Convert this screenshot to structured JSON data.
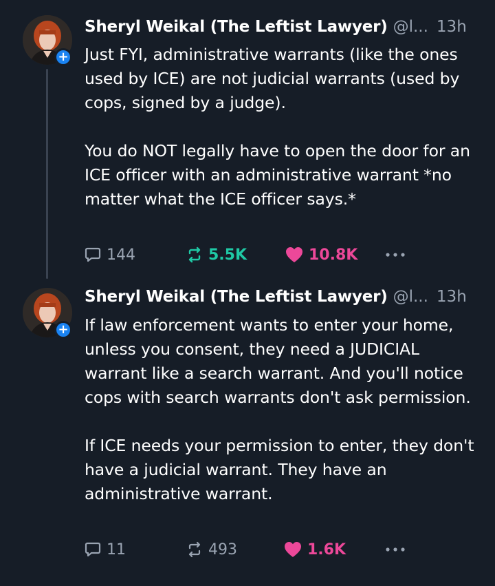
{
  "colors": {
    "background": "#161d27",
    "text": "#ffffff",
    "muted": "#9aa4b2",
    "repost_active": "#1fc9a5",
    "like_active": "#ec4899",
    "follow_badge": "#1a83f2",
    "thread_line": "#3a4351"
  },
  "posts": [
    {
      "author": {
        "display_name": "Sheryl Weikal (The Leftist Lawyer)",
        "handle": "@l...",
        "avatar_icon": "user-avatar"
      },
      "timestamp": "13h",
      "paragraphs": [
        "Just FYI, administrative warrants (like the ones used by ICE) are not judicial warrants (used by cops, signed by a judge).",
        "You do NOT legally have to open the door for an ICE officer with an administrative warrant *no matter what the ICE officer says.*"
      ],
      "stats": {
        "replies": "144",
        "reposts": "5.5K",
        "likes": "10.8K"
      },
      "reposted": true,
      "liked": true
    },
    {
      "author": {
        "display_name": "Sheryl Weikal (The Leftist Lawyer)",
        "handle": "@l...",
        "avatar_icon": "user-avatar"
      },
      "timestamp": "13h",
      "paragraphs": [
        "If law enforcement wants to enter your home, unless you consent, they need a JUDICIAL warrant like a search warrant. And you'll notice cops with search warrants don't ask permission.",
        "If ICE needs your permission to enter, they don't have a judicial warrant. They have an administrative warrant."
      ],
      "stats": {
        "replies": "11",
        "reposts": "493",
        "likes": "1.6K"
      },
      "reposted": false,
      "liked": true
    }
  ],
  "icons": {
    "reply": "reply-icon",
    "repost": "repost-icon",
    "like": "heart-icon",
    "more": "more-options-icon",
    "follow": "plus-icon"
  }
}
